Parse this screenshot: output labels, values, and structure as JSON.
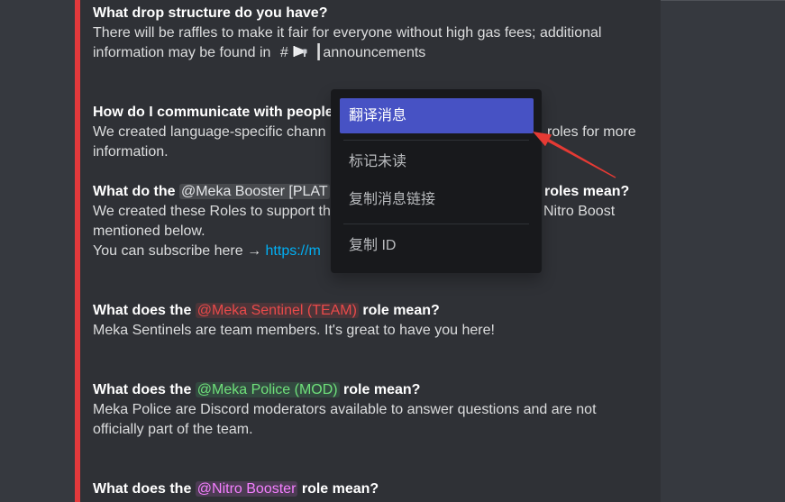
{
  "colors": {
    "chat_bg": "#36393f",
    "embed_bg": "#2f3136",
    "embed_accent": "#e3393c",
    "text_normal": "#dcddde",
    "text_heading": "#ffffff",
    "link": "#00aff4",
    "mention_booster_text": "#e3e5e8",
    "mention_booster_bg": "rgba(255,255,255,0.12)",
    "mention_sentinel_text": "#e94a4a",
    "mention_sentinel_bg": "rgba(233,74,74,0.16)",
    "mention_police_text": "#6fe07a",
    "mention_police_bg": "rgba(87,242,135,0.13)",
    "mention_nitro_text": "#f47fff",
    "mention_nitro_bg": "rgba(244,127,255,0.15)",
    "menu_bg": "#18191c",
    "menu_text": "#b9bbbe",
    "menu_highlight": "#4752c4",
    "menu_highlight_text": "#ffffff",
    "menu_separator": "#2f3136",
    "annotation_arrow": "#e53a34"
  },
  "faq": {
    "drop": {
      "title": "What drop structure do you have?",
      "line1": "There will be raffles to make it fair for everyone without high gas fees; additional",
      "line2_prefix": "information may be found in ",
      "channel_hash": "#",
      "channel_icon": "megaphone-icon",
      "channel_name": "┃announcements"
    },
    "communicate": {
      "title": "How do I communicate with people",
      "line1_left": "We created language-specific chann",
      "line1_right": "roles for more",
      "line2": "information."
    },
    "booster": {
      "title_prefix": "What do the ",
      "mention": "@Meka Booster [PLAT",
      "title_right": "roles mean?",
      "line1_left": "We created these Roles to support th",
      "line1_right": "Nitro Boost",
      "line2": "mentioned below.",
      "line3_prefix": "You can subscribe here → ",
      "link": "https://m"
    },
    "sentinel": {
      "title_prefix": "What does the ",
      "mention": "@Meka Sentinel (TEAM)",
      "title_suffix": " role mean?",
      "line1": "Meka Sentinels are team members. It's great to have you here!"
    },
    "police": {
      "title_prefix": "What does the ",
      "mention": "@Meka Police (MOD)",
      "title_suffix": " role mean?",
      "line1": "Meka Police are Discord moderators available to answer questions and are not",
      "line2": "officially part of the team."
    },
    "nitro": {
      "title_prefix": "What does the ",
      "mention": "@Nitro Booster",
      "title_suffix": " role mean?"
    }
  },
  "context_menu": {
    "items": [
      {
        "label": "翻译消息",
        "highlighted": true
      },
      {
        "label": "标记未读"
      },
      {
        "label": "复制消息链接"
      },
      {
        "label": "复制 ID"
      }
    ]
  }
}
